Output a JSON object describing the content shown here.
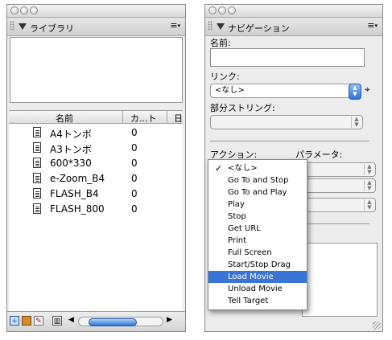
{
  "library": {
    "title": "ライブラリ",
    "menu_icon": "≡",
    "columns": [
      "名前",
      "カ...ト",
      "日"
    ],
    "items": [
      {
        "name": "A4トンボ",
        "count": "0"
      },
      {
        "name": "A3トンボ",
        "count": "0"
      },
      {
        "name": "600*330",
        "count": "0"
      },
      {
        "name": "e-Zoom_B4",
        "count": "0"
      },
      {
        "name": "FLASH_B4",
        "count": "0"
      },
      {
        "name": "FLASH_800",
        "count": "0"
      }
    ],
    "icons": [
      "new-symbol-icon",
      "new-folder-icon",
      "properties-icon",
      "delete-icon"
    ]
  },
  "navigation": {
    "title": "ナビゲーション",
    "menu_icon": "≡",
    "name_label": "名前:",
    "name_value": "",
    "link_label": "リンク:",
    "link_value": "<なし>",
    "substring_label": "部分ストリング:",
    "action_label": "アクション:",
    "parameter_label": "パラメータ:",
    "action_menu": {
      "items": [
        "<なし>",
        "Go To and Stop",
        "Go To and Play",
        "Play",
        "Stop",
        "Get URL",
        "Print",
        "Full Screen",
        "Start/Stop Drag",
        "Load Movie",
        "Unload Movie",
        "Tell Target"
      ],
      "checked": "<なし>",
      "highlighted": "Load Movie"
    }
  },
  "colors": {
    "accent": "#3875d7",
    "panel_bg": "#ececec"
  }
}
